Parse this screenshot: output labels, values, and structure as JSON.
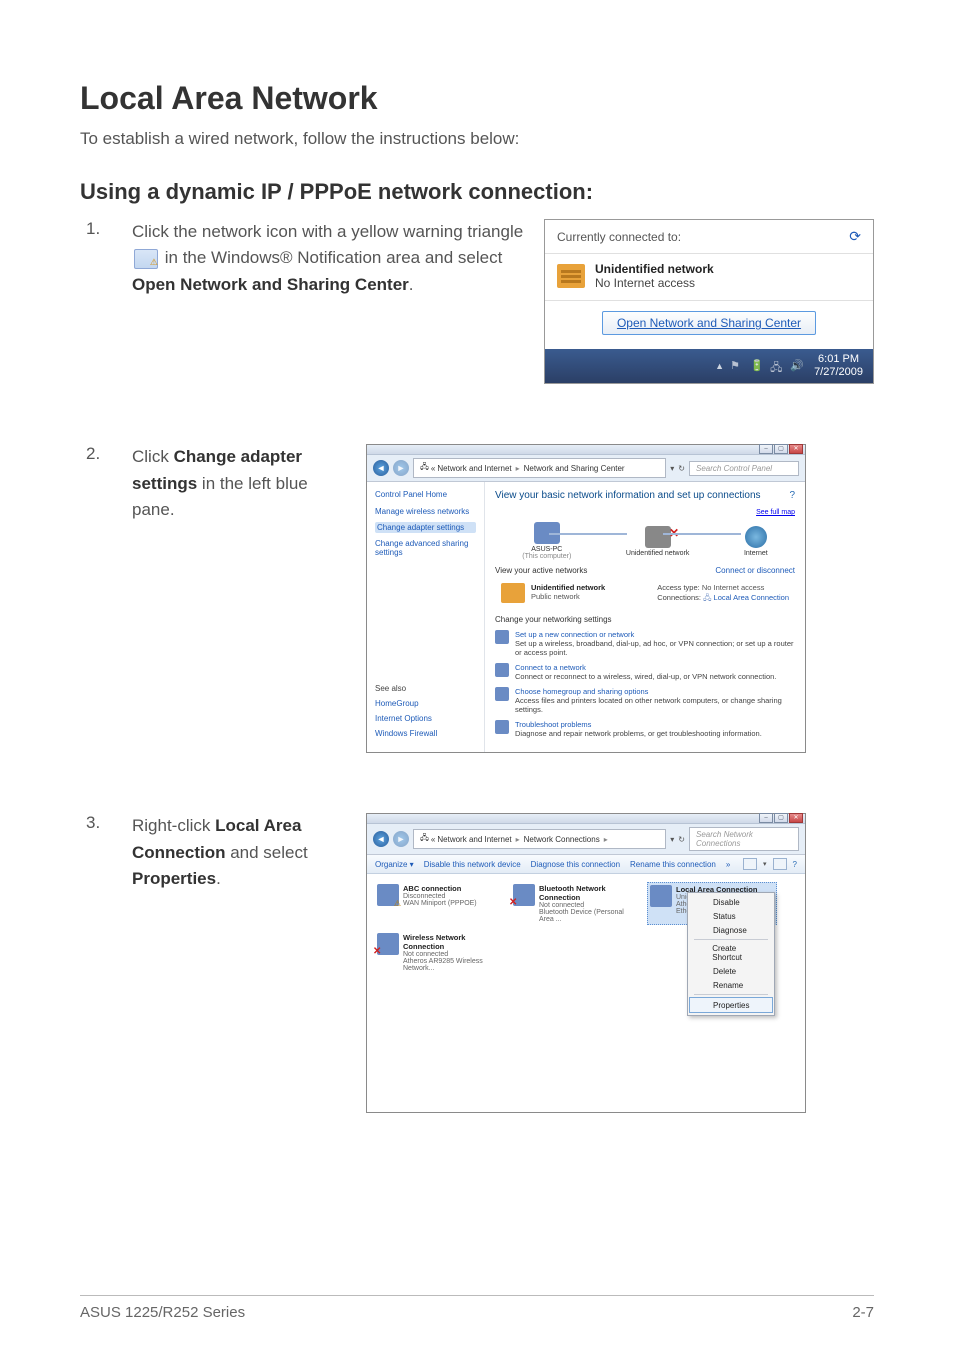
{
  "page": {
    "title": "Local Area Network",
    "intro": "To establish a wired network, follow the instructions below:",
    "subtitle": "Using a dynamic IP / PPPoE network connection:"
  },
  "step1": {
    "num": "1.",
    "text_before": "Click the network icon with a yellow warning triangle ",
    "text_after": " in the Windows® Notification area and select ",
    "bold": "Open Network and Sharing Center",
    "period": "."
  },
  "step2": {
    "num": "2.",
    "text_before": "Click ",
    "bold": "Change adapter settings",
    "text_after": " in the left blue pane."
  },
  "step3": {
    "num": "3.",
    "text_before": "Right-click ",
    "bold": "Local Area Connection",
    "text_mid": " and select ",
    "bold2": "Properties",
    "period": "."
  },
  "flyout": {
    "header": "Currently connected to:",
    "net_name": "Unidentified network",
    "net_status": "No Internet access",
    "link": "Open Network and Sharing Center",
    "time": "6:01 PM",
    "date": "7/27/2009"
  },
  "nsc": {
    "crumb_root": "«",
    "crumb_1": "Network and Internet",
    "crumb_2": "Network and Sharing Center",
    "search_placeholder": "Search Control Panel",
    "cph": "Control Panel Home",
    "left_links": [
      "Manage wireless networks",
      "Change adapter settings",
      "Change advanced sharing settings"
    ],
    "see_also": "See also",
    "bottom_links": [
      "HomeGroup",
      "Internet Options",
      "Windows Firewall"
    ],
    "title": "View your basic network information and set up connections",
    "full_map": "See full map",
    "node_pc": "ASUS-PC",
    "node_pc_sub": "(This computer)",
    "node_unid": "Unidentified network",
    "node_inet": "Internet",
    "active_header": "View your active networks",
    "conn_disc": "Connect or disconnect",
    "unid_name": "Unidentified network",
    "unid_type": "Public network",
    "access_k": "Access type:",
    "access_v": "No Internet access",
    "conn_k": "Connections:",
    "conn_v": "Local Area Connection",
    "change_header": "Change your networking settings",
    "links": [
      {
        "t": "Set up a new connection or network",
        "d": "Set up a wireless, broadband, dial-up, ad hoc, or VPN connection; or set up a router or access point."
      },
      {
        "t": "Connect to a network",
        "d": "Connect or reconnect to a wireless, wired, dial-up, or VPN network connection."
      },
      {
        "t": "Choose homegroup and sharing options",
        "d": "Access files and printers located on other network computers, or change sharing settings."
      },
      {
        "t": "Troubleshoot problems",
        "d": "Diagnose and repair network problems, or get troubleshooting information."
      }
    ]
  },
  "netconn": {
    "crumb_1": "Network and Internet",
    "crumb_2": "Network Connections",
    "search_placeholder": "Search Network Connections",
    "organize": "Organize ▾",
    "tb": [
      "Disable this network device",
      "Diagnose this connection",
      "Rename this connection"
    ],
    "more": "»",
    "conns": [
      {
        "name": "ABC connection",
        "l2": "Disconnected",
        "l3": "WAN Miniport (PPPOE)"
      },
      {
        "name": "Bluetooth Network Connection",
        "l2": "Not connected",
        "l3": "Bluetooth Device (Personal Area ..."
      },
      {
        "name": "Local Area Connection",
        "l2": "Unidentified network",
        "l3": "Atheros AR8132 PCI-E Fast Ethern..."
      },
      {
        "name": "Wireless Network Connection",
        "l2": "Not connected",
        "l3": "Atheros AR9285 Wireless Network..."
      }
    ],
    "menu": [
      "Disable",
      "Status",
      "Diagnose",
      "Create Shortcut",
      "Delete",
      "Rename",
      "Properties"
    ]
  },
  "footer": {
    "left": "ASUS 1225/R252 Series",
    "right": "2-7"
  }
}
